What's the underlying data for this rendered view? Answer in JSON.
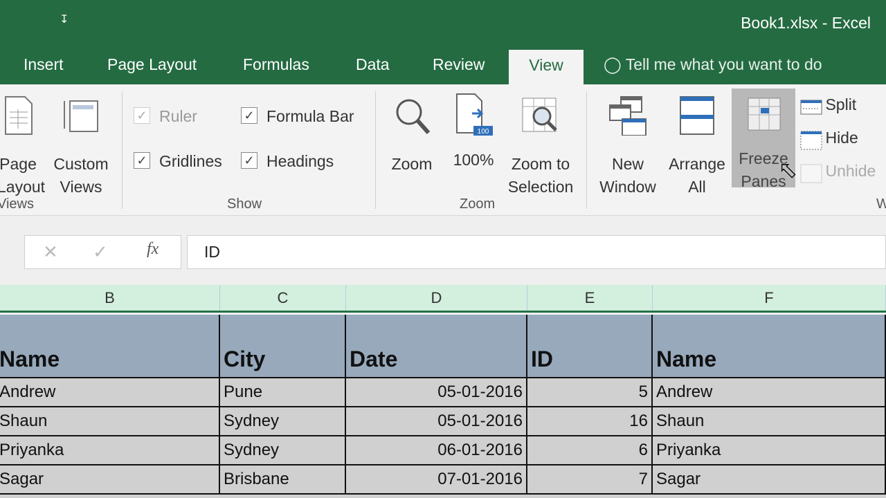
{
  "window": {
    "title": "Book1.xlsx - Excel",
    "qat_icon": "customize-qat-icon"
  },
  "tabs": [
    "Insert",
    "Page Layout",
    "Formulas",
    "Data",
    "Review",
    "View"
  ],
  "active_tab": "View",
  "tell_me": "Tell me what you want to do",
  "ribbon": {
    "views": {
      "label": "Views",
      "page_layout": [
        "Page",
        "Layout"
      ],
      "custom_views": [
        "Custom",
        "Views"
      ]
    },
    "show": {
      "label": "Show",
      "ruler": {
        "label": "Ruler",
        "checked": true,
        "disabled": true
      },
      "formula_bar": {
        "label": "Formula Bar",
        "checked": true
      },
      "gridlines": {
        "label": "Gridlines",
        "checked": true
      },
      "headings": {
        "label": "Headings",
        "checked": true
      }
    },
    "zoom": {
      "label": "Zoom",
      "zoom": "Zoom",
      "hundred": "100%",
      "badge": "100",
      "zoom_sel": [
        "Zoom to",
        "Selection"
      ]
    },
    "window": {
      "label": "W",
      "new_window": [
        "New",
        "Window"
      ],
      "arrange_all": [
        "Arrange",
        "All"
      ],
      "freeze": [
        "Freeze",
        "Panes"
      ],
      "split": "Split",
      "hide": "Hide",
      "unhide": "Unhide"
    }
  },
  "formula_bar": {
    "value": "ID"
  },
  "columns": [
    "B",
    "C",
    "D",
    "E",
    "F"
  ],
  "table": {
    "headers": [
      "Name",
      "City",
      "Date",
      "ID",
      "Name"
    ],
    "rows": [
      [
        "Andrew",
        "Pune",
        "05-01-2016",
        "5",
        "Andrew"
      ],
      [
        "Shaun",
        "Sydney",
        "05-01-2016",
        "16",
        "Shaun"
      ],
      [
        "Priyanka",
        "Sydney",
        "06-01-2016",
        "6",
        "Priyanka"
      ],
      [
        "Sagar",
        "Brisbane",
        "07-01-2016",
        "7",
        "Sagar"
      ]
    ]
  },
  "colors": {
    "brand": "#217346",
    "header_fill": "#97a9bb",
    "data_fill": "#d0d0d0"
  }
}
